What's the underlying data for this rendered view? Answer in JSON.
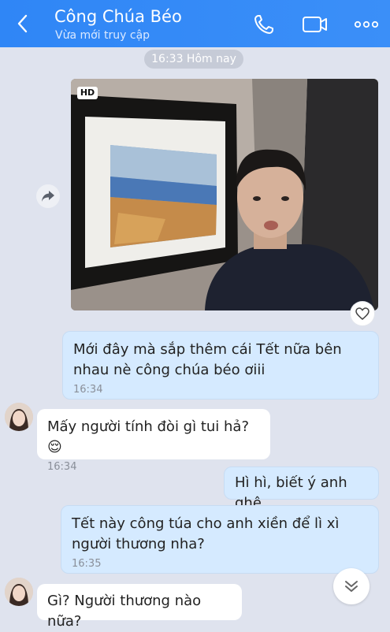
{
  "header": {
    "title": "Công Chúa Béo",
    "subtitle": "Vừa mới truy cập",
    "back_icon": "chevron-left-icon",
    "call_icon": "phone-icon",
    "video_icon": "video-camera-icon",
    "more_icon": "more-dots-icon"
  },
  "chat": {
    "date_chip": "16:33 Hôm nay",
    "photo": {
      "badge": "HD",
      "share_icon": "share-arrow-icon",
      "like_icon": "heart-icon"
    },
    "messages": [
      {
        "side": "out",
        "text": "Mới đây mà sắp thêm cái Tết nữa bên nhau nè công chúa béo ơiii",
        "time": "16:34"
      },
      {
        "side": "in",
        "text": "Mấy người tính đòi gì tui hả? 😌",
        "time": "16:34"
      },
      {
        "side": "out",
        "text": "Hì hì, biết ý anh ghê",
        "time": ""
      },
      {
        "side": "out",
        "text": "Tết này công túa cho anh xiền để lì xì người thương nha?",
        "time": "16:35"
      },
      {
        "side": "in",
        "text": "Gì? Người thương nào nữa?",
        "time": ""
      }
    ],
    "scroll_icon": "chevrons-down-icon"
  },
  "colors": {
    "header": "#3b8ff8",
    "outgoing": "#d5eaff",
    "incoming": "#ffffff",
    "background": "#dfe3ee"
  }
}
